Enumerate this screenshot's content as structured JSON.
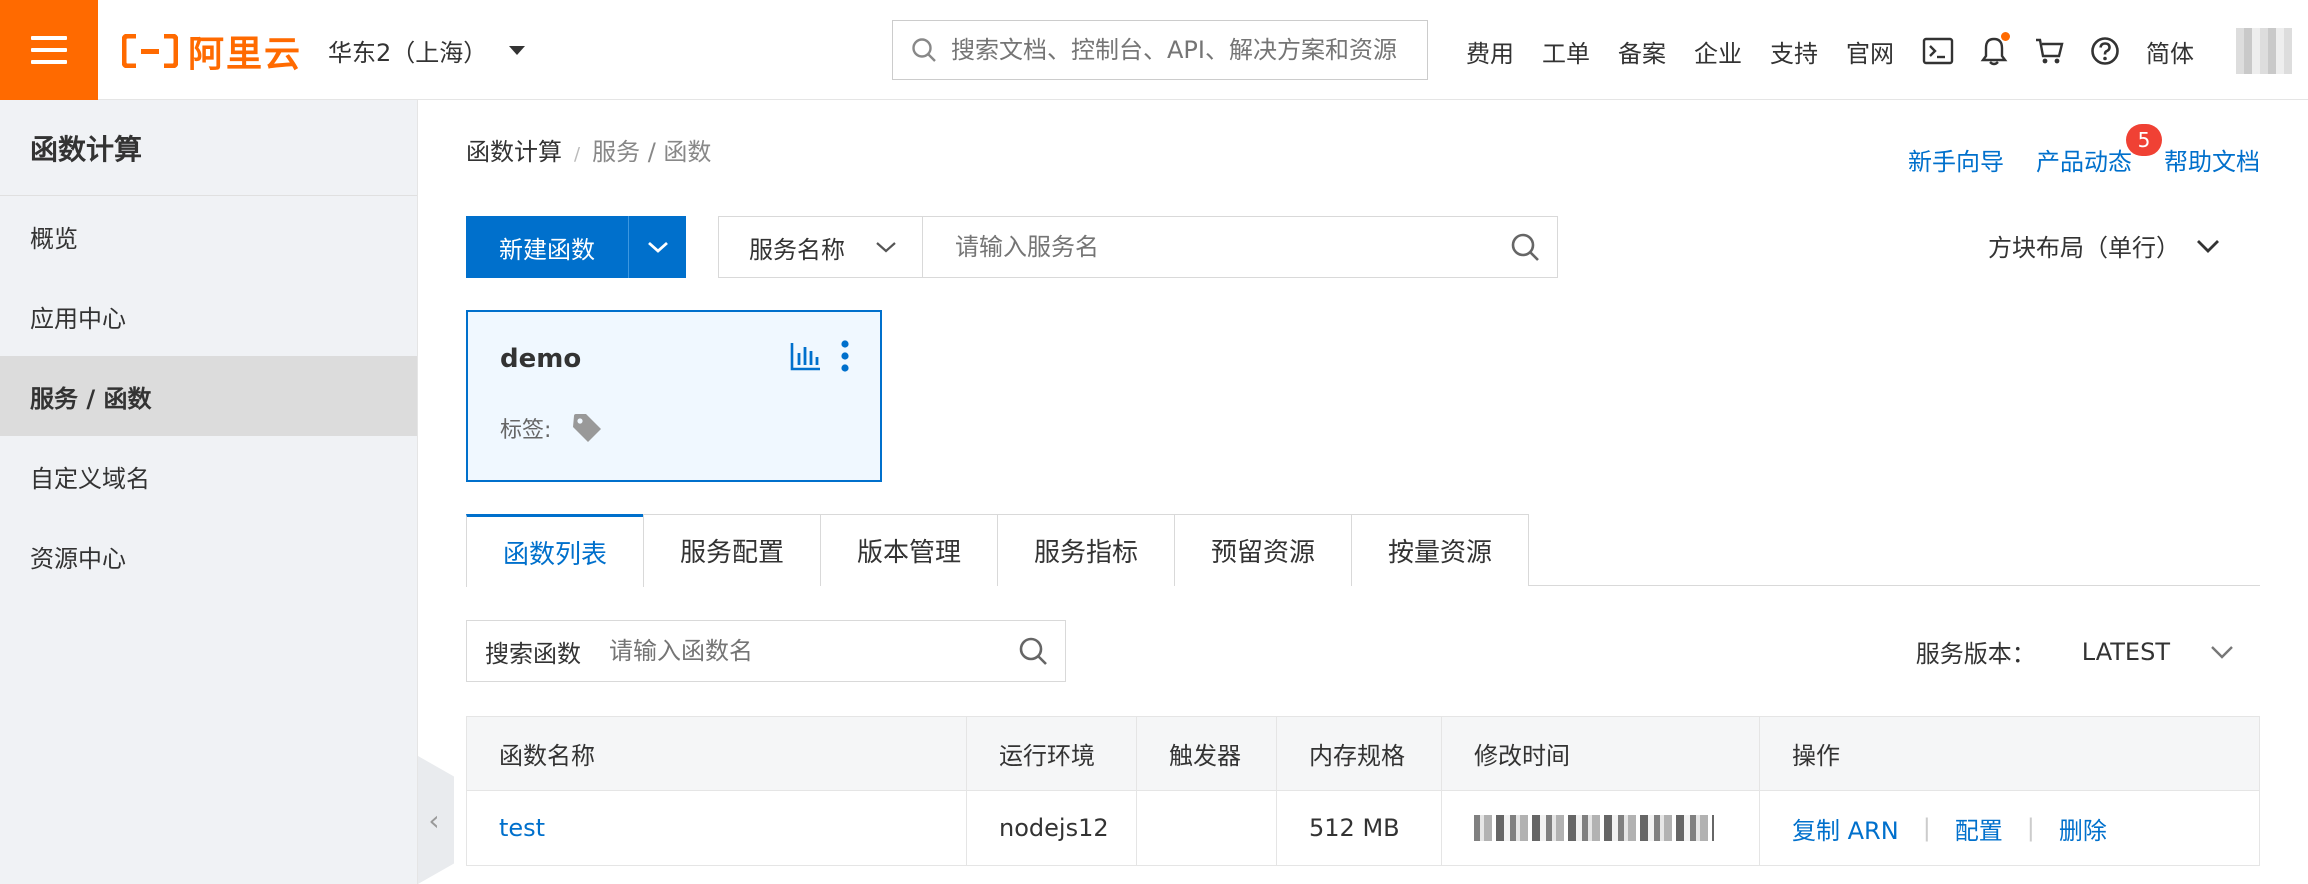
{
  "header": {
    "brand": "阿里云",
    "region": "华东2（上海）",
    "search_placeholder": "搜索文档、控制台、API、解决方案和资源",
    "nav": [
      "费用",
      "工单",
      "备案",
      "企业",
      "支持",
      "官网"
    ],
    "language": "简体",
    "icons": [
      "terminal-icon",
      "bell-icon",
      "cart-icon",
      "help-icon"
    ],
    "accent_color": "#ff6a00"
  },
  "sidebar": {
    "title": "函数计算",
    "items": [
      {
        "label": "概览",
        "active": false
      },
      {
        "label": "应用中心",
        "active": false
      },
      {
        "label": "服务 / 函数",
        "active": true
      },
      {
        "label": "自定义域名",
        "active": false
      },
      {
        "label": "资源中心",
        "active": false
      }
    ]
  },
  "breadcrumb": {
    "root": "函数计算",
    "sep": "/",
    "current": "服务 / 函数"
  },
  "help_links": {
    "guide": "新手向导",
    "updates": "产品动态",
    "updates_badge": "5",
    "docs": "帮助文档"
  },
  "toolbar": {
    "new_function": "新建函数",
    "service_filter_label": "服务名称",
    "service_placeholder": "请输入服务名",
    "layout_label": "方块布局（单行）"
  },
  "service_card": {
    "name": "demo",
    "tags_label": "标签:"
  },
  "tabs": [
    "函数列表",
    "服务配置",
    "版本管理",
    "服务指标",
    "预留资源",
    "按量资源"
  ],
  "function_search": {
    "label": "搜索函数",
    "placeholder": "请输入函数名"
  },
  "version": {
    "label": "服务版本：",
    "value": "LATEST"
  },
  "table": {
    "columns": [
      "函数名称",
      "运行环境",
      "触发器",
      "内存规格",
      "修改时间",
      "操作"
    ],
    "rows": [
      {
        "name": "test",
        "runtime": "nodejs12",
        "trigger": "",
        "memory": "512 MB",
        "modified": "",
        "ops": [
          "复制 ARN",
          "配置",
          "删除"
        ]
      }
    ]
  },
  "colors": {
    "primary": "#0070cc",
    "orange": "#ff6a00",
    "badge": "#f04134"
  }
}
